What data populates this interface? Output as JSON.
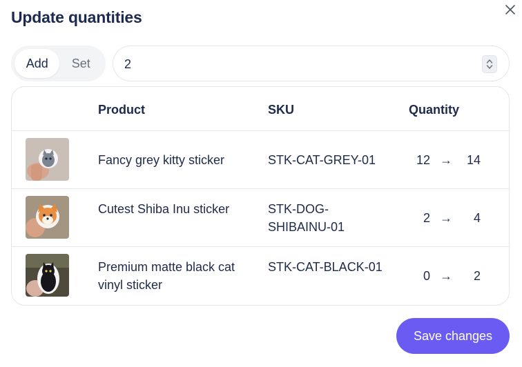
{
  "dialog": {
    "title": "Update quantities",
    "close_icon": "close-icon"
  },
  "mode_toggle": {
    "options": [
      "Add",
      "Set"
    ],
    "selected": "Add"
  },
  "quantity_input": {
    "value": "2",
    "spinner_icon": "chevron-up-down-icon"
  },
  "table": {
    "columns": [
      "",
      "Product",
      "SKU",
      "Quantity"
    ],
    "rows": [
      {
        "thumbnail_icon": "grey-kitty-sticker-photo",
        "product": "Fancy grey kitty sticker",
        "sku": "STK-CAT-GREY-01",
        "from": "12",
        "to": "14"
      },
      {
        "thumbnail_icon": "shiba-inu-sticker-photo",
        "product": "Cutest Shiba Inu sticker",
        "sku": "STK-DOG-SHIBAINU-01",
        "from": "2",
        "to": "4"
      },
      {
        "thumbnail_icon": "black-cat-sticker-photo",
        "product": "Premium matte black cat vinyl sticker",
        "sku": "STK-CAT-BLACK-01",
        "from": "0",
        "to": "2"
      }
    ],
    "arrow": "→"
  },
  "footer": {
    "save_label": "Save changes"
  },
  "colors": {
    "primary": "#6a5cf3",
    "heading": "#1b2a4e",
    "border": "#e3e6eb"
  }
}
